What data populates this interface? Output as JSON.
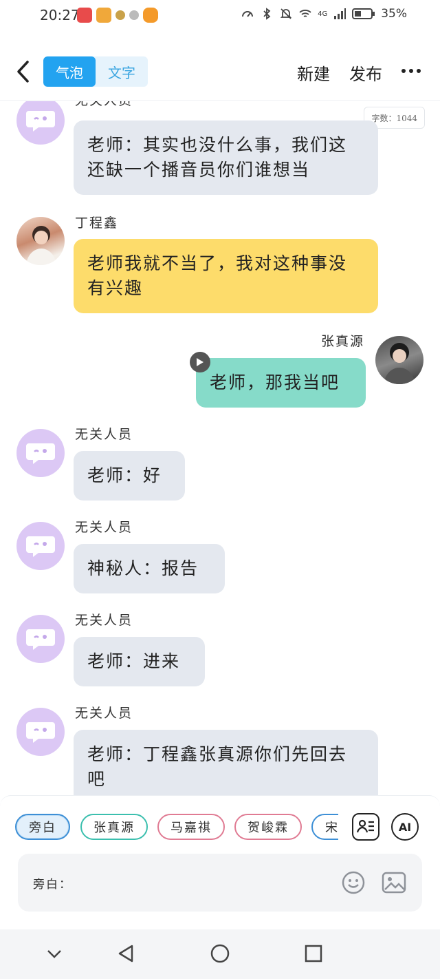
{
  "status_bar": {
    "time": "20:27",
    "battery": "35%",
    "network": "4G",
    "app_icons": [
      "app-icon-1",
      "app-icon-2",
      "app-icon-3",
      "app-icon-4",
      "app-icon-5"
    ]
  },
  "header": {
    "segments": [
      "气泡",
      "文字"
    ],
    "active_segment": "气泡",
    "new_label": "新建",
    "publish_label": "发布",
    "more_icon": "more-dots-icon"
  },
  "word_count": "字数：1044",
  "messages": [
    {
      "id": "m1",
      "sender": "无关人员",
      "side": "left",
      "avatar": "bot-avatar",
      "style": "gray",
      "text": "老师：其实也没什么事，我们这还缺一个播音员你们谁想当"
    },
    {
      "id": "m2",
      "sender": "丁程鑫",
      "side": "left",
      "avatar": "photo-avatar",
      "style": "yellow",
      "text": "老师我就不当了，我对这种事没有兴趣"
    },
    {
      "id": "m3",
      "sender": "张真源",
      "side": "right",
      "avatar": "photo-avatar",
      "style": "teal",
      "text": "老师，那我当吧"
    },
    {
      "id": "m4",
      "sender": "无关人员",
      "side": "left",
      "avatar": "bot-avatar",
      "style": "gray",
      "text": "老师：好"
    },
    {
      "id": "m5",
      "sender": "无关人员",
      "side": "left",
      "avatar": "bot-avatar",
      "style": "gray",
      "text": "神秘人：报告"
    },
    {
      "id": "m6",
      "sender": "无关人员",
      "side": "left",
      "avatar": "bot-avatar",
      "style": "gray",
      "text": "老师：进来"
    },
    {
      "id": "m7",
      "sender": "无关人员",
      "side": "left",
      "avatar": "bot-avatar",
      "style": "gray",
      "text": "老师：丁程鑫张真源你们先回去吧"
    }
  ],
  "roles": [
    {
      "label": "旁白",
      "color": "#3d8fd6",
      "selected": true
    },
    {
      "label": "张真源",
      "color": "#3bbfae",
      "selected": false
    },
    {
      "label": "马嘉祺",
      "color": "#e07b93",
      "selected": false
    },
    {
      "label": "贺峻霖",
      "color": "#e07b93",
      "selected": false
    },
    {
      "label": "宋",
      "color": "#3d8fd6",
      "selected": false
    }
  ],
  "input": {
    "label": "旁白："
  },
  "colors": {
    "accent": "#23a3f0",
    "bubble_gray": "#e4e8ef",
    "bubble_yellow": "#fddc6b",
    "bubble_teal": "#86dbc9",
    "bot_avatar": "#dcc8f5"
  }
}
